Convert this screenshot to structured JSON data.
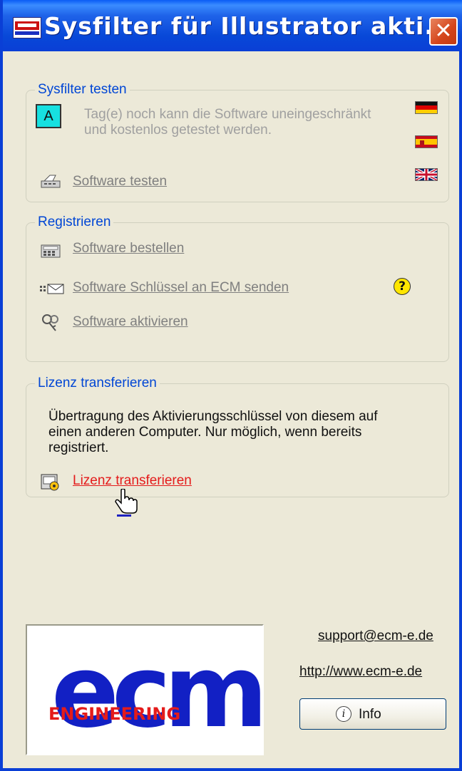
{
  "window": {
    "title": "Sysfilter für Illustrator akti...",
    "close_glyph": "✕"
  },
  "test_group": {
    "legend": "Sysfilter testen",
    "badge": "A",
    "description": "Tag(e) noch kann die Software uneingeschränkt und kostenlos getestet werden.",
    "test_link": "Software testen",
    "flags": [
      "de-flag-icon",
      "es-flag-icon",
      "uk-flag-icon"
    ]
  },
  "register_group": {
    "legend": "Registrieren",
    "order_link": "Software bestellen",
    "send_key_link": "Software Schlüssel an ECM senden",
    "activate_link": "Software aktivieren",
    "help_icon": "question-help-icon"
  },
  "transfer_group": {
    "legend": "Lizenz transferieren",
    "description": "Übertragung des Aktivierungsschlüssel von diesem auf einen anderen Computer. Nur möglich, wenn bereits registriert.",
    "transfer_link": "Lizenz transferieren"
  },
  "footer": {
    "logo_text": "ecm",
    "logo_subtext": "ENGINEERING",
    "support_email": "support@ecm-e.de",
    "website": "http://www.ecm-e.de",
    "info_button_label": "Info"
  },
  "colors": {
    "titlebar": "#0A3FD6",
    "legend_text": "#0046D5",
    "disabled_text": "#7F7F7F",
    "active_link": "#E41B1B",
    "logo_blue": "#1220C4",
    "logo_red": "#E41B1B"
  }
}
